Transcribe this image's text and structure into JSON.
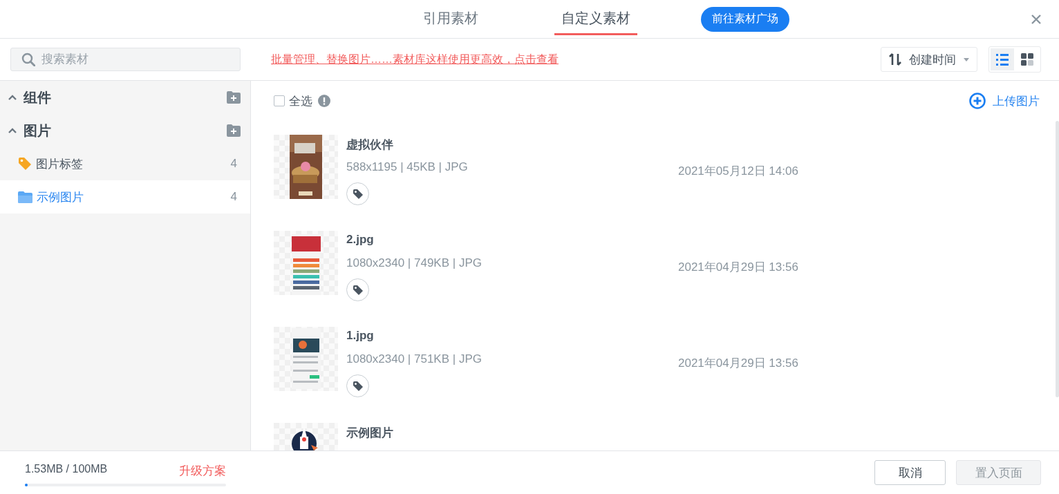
{
  "header": {
    "tabs": [
      {
        "label": "引用素材",
        "selected": false
      },
      {
        "label": "自定义素材",
        "selected": true
      }
    ],
    "market_button": "前往素材广场"
  },
  "toolbar": {
    "search": {
      "placeholder": "搜索素材"
    },
    "notice_link": "批量管理、替换图片……素材库这样使用更高效，点击查看",
    "sort": {
      "label": "创建时间"
    },
    "view_modes": [
      {
        "kind": "list",
        "selected": true
      },
      {
        "kind": "grid",
        "selected": false
      }
    ]
  },
  "sidebar": {
    "groups": [
      {
        "label": "组件",
        "expanded": true
      },
      {
        "label": "图片",
        "expanded": true,
        "children": [
          {
            "label": "图片标签",
            "kind": "tag",
            "count": "4",
            "selected": false
          },
          {
            "label": "示例图片",
            "kind": "folder",
            "count": "4",
            "selected": true
          }
        ]
      }
    ]
  },
  "content": {
    "select_all": {
      "label": "全选",
      "checked": false
    },
    "upload": "上传图片",
    "items": [
      {
        "name": "虚拟伙伴",
        "meta": "588x1195 | 45KB | JPG",
        "date": "2021年05月12日 14:06"
      },
      {
        "name": "2.jpg",
        "meta": "1080x2340 | 749KB | JPG",
        "date": "2021年04月29日 13:56"
      },
      {
        "name": "1.jpg",
        "meta": "1080x2340 | 751KB | JPG",
        "date": "2021年04月29日 13:56"
      },
      {
        "name": "示例图片"
      }
    ]
  },
  "footer": {
    "storage": "1.53MB / 100MB",
    "level": 0.015,
    "upgrade": "升级方案",
    "buttons": [
      {
        "label": "取消",
        "disabled": false
      },
      {
        "label": "置入页面",
        "disabled": true
      }
    ]
  }
}
